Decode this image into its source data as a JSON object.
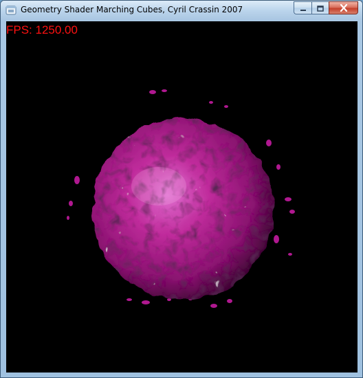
{
  "window": {
    "title": "Geometry Shader Marching Cubes, Cyril Crassin 2007",
    "icon": "app-window-icon",
    "buttons": {
      "minimize": "minimize-icon",
      "maximize": "maximize-icon",
      "close": "close-icon"
    }
  },
  "overlay": {
    "fps_text": "FPS: 1250.00",
    "fps_color": "#ff1111"
  },
  "scene": {
    "background_color": "#000000",
    "blob_color": "#c2189a"
  }
}
